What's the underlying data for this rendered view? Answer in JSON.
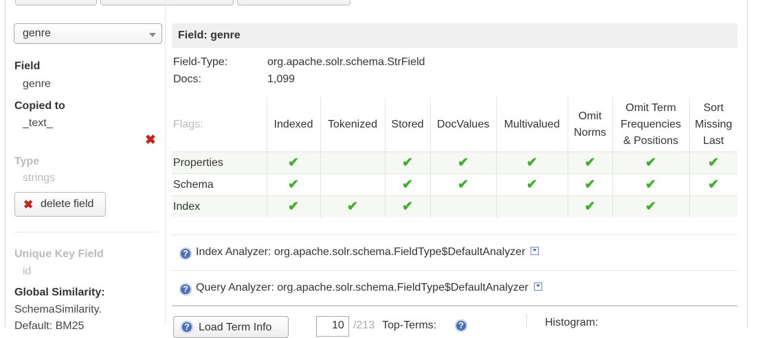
{
  "sidebar": {
    "select_value": "genre",
    "field_label": "Field",
    "field_value": "genre",
    "copied_label": "Copied to",
    "copied_value": "_text_",
    "type_label": "Type",
    "type_value": "strings",
    "delete_button": "delete field",
    "unique_key_label": "Unique Key Field",
    "unique_key_value": "id",
    "global_similarity_label": "Global Similarity:",
    "global_similarity_value": "SchemaSimilarity.",
    "global_similarity_value2": "Default: BM25"
  },
  "main": {
    "header": "Field: genre",
    "field_type_label": "Field-Type:",
    "field_type_value": "org.apache.solr.schema.StrField",
    "docs_label": "Docs:",
    "docs_value": "1,099",
    "flags_label": "Flags:",
    "columns": [
      "Indexed",
      "Tokenized",
      "Stored",
      "DocValues",
      "Multivalued",
      "Omit\nNorms",
      "Omit Term\nFrequencies\n& Positions",
      "Sort\nMissing\nLast"
    ],
    "rows": [
      {
        "label": "Properties",
        "flags": [
          true,
          false,
          true,
          true,
          true,
          true,
          true,
          true
        ]
      },
      {
        "label": "Schema",
        "flags": [
          true,
          false,
          true,
          true,
          true,
          true,
          true,
          true
        ]
      },
      {
        "label": "Index",
        "flags": [
          true,
          true,
          true,
          false,
          false,
          true,
          true,
          false
        ]
      }
    ],
    "index_analyzer_label": "Index Analyzer:",
    "index_analyzer_value": "org.apache.solr.schema.FieldType$DefaultAnalyzer",
    "query_analyzer_label": "Query Analyzer:",
    "query_analyzer_value": "org.apache.solr.schema.FieldType$DefaultAnalyzer",
    "load_button": "Load Term Info",
    "topterms_value": "10",
    "topterms_total": "/213",
    "topterms_label": "Top-Terms:",
    "histogram_label": "Histogram:"
  },
  "colors": {
    "check": "#3fae29",
    "delete": "#c8201c",
    "help": "#4a6fb3"
  }
}
